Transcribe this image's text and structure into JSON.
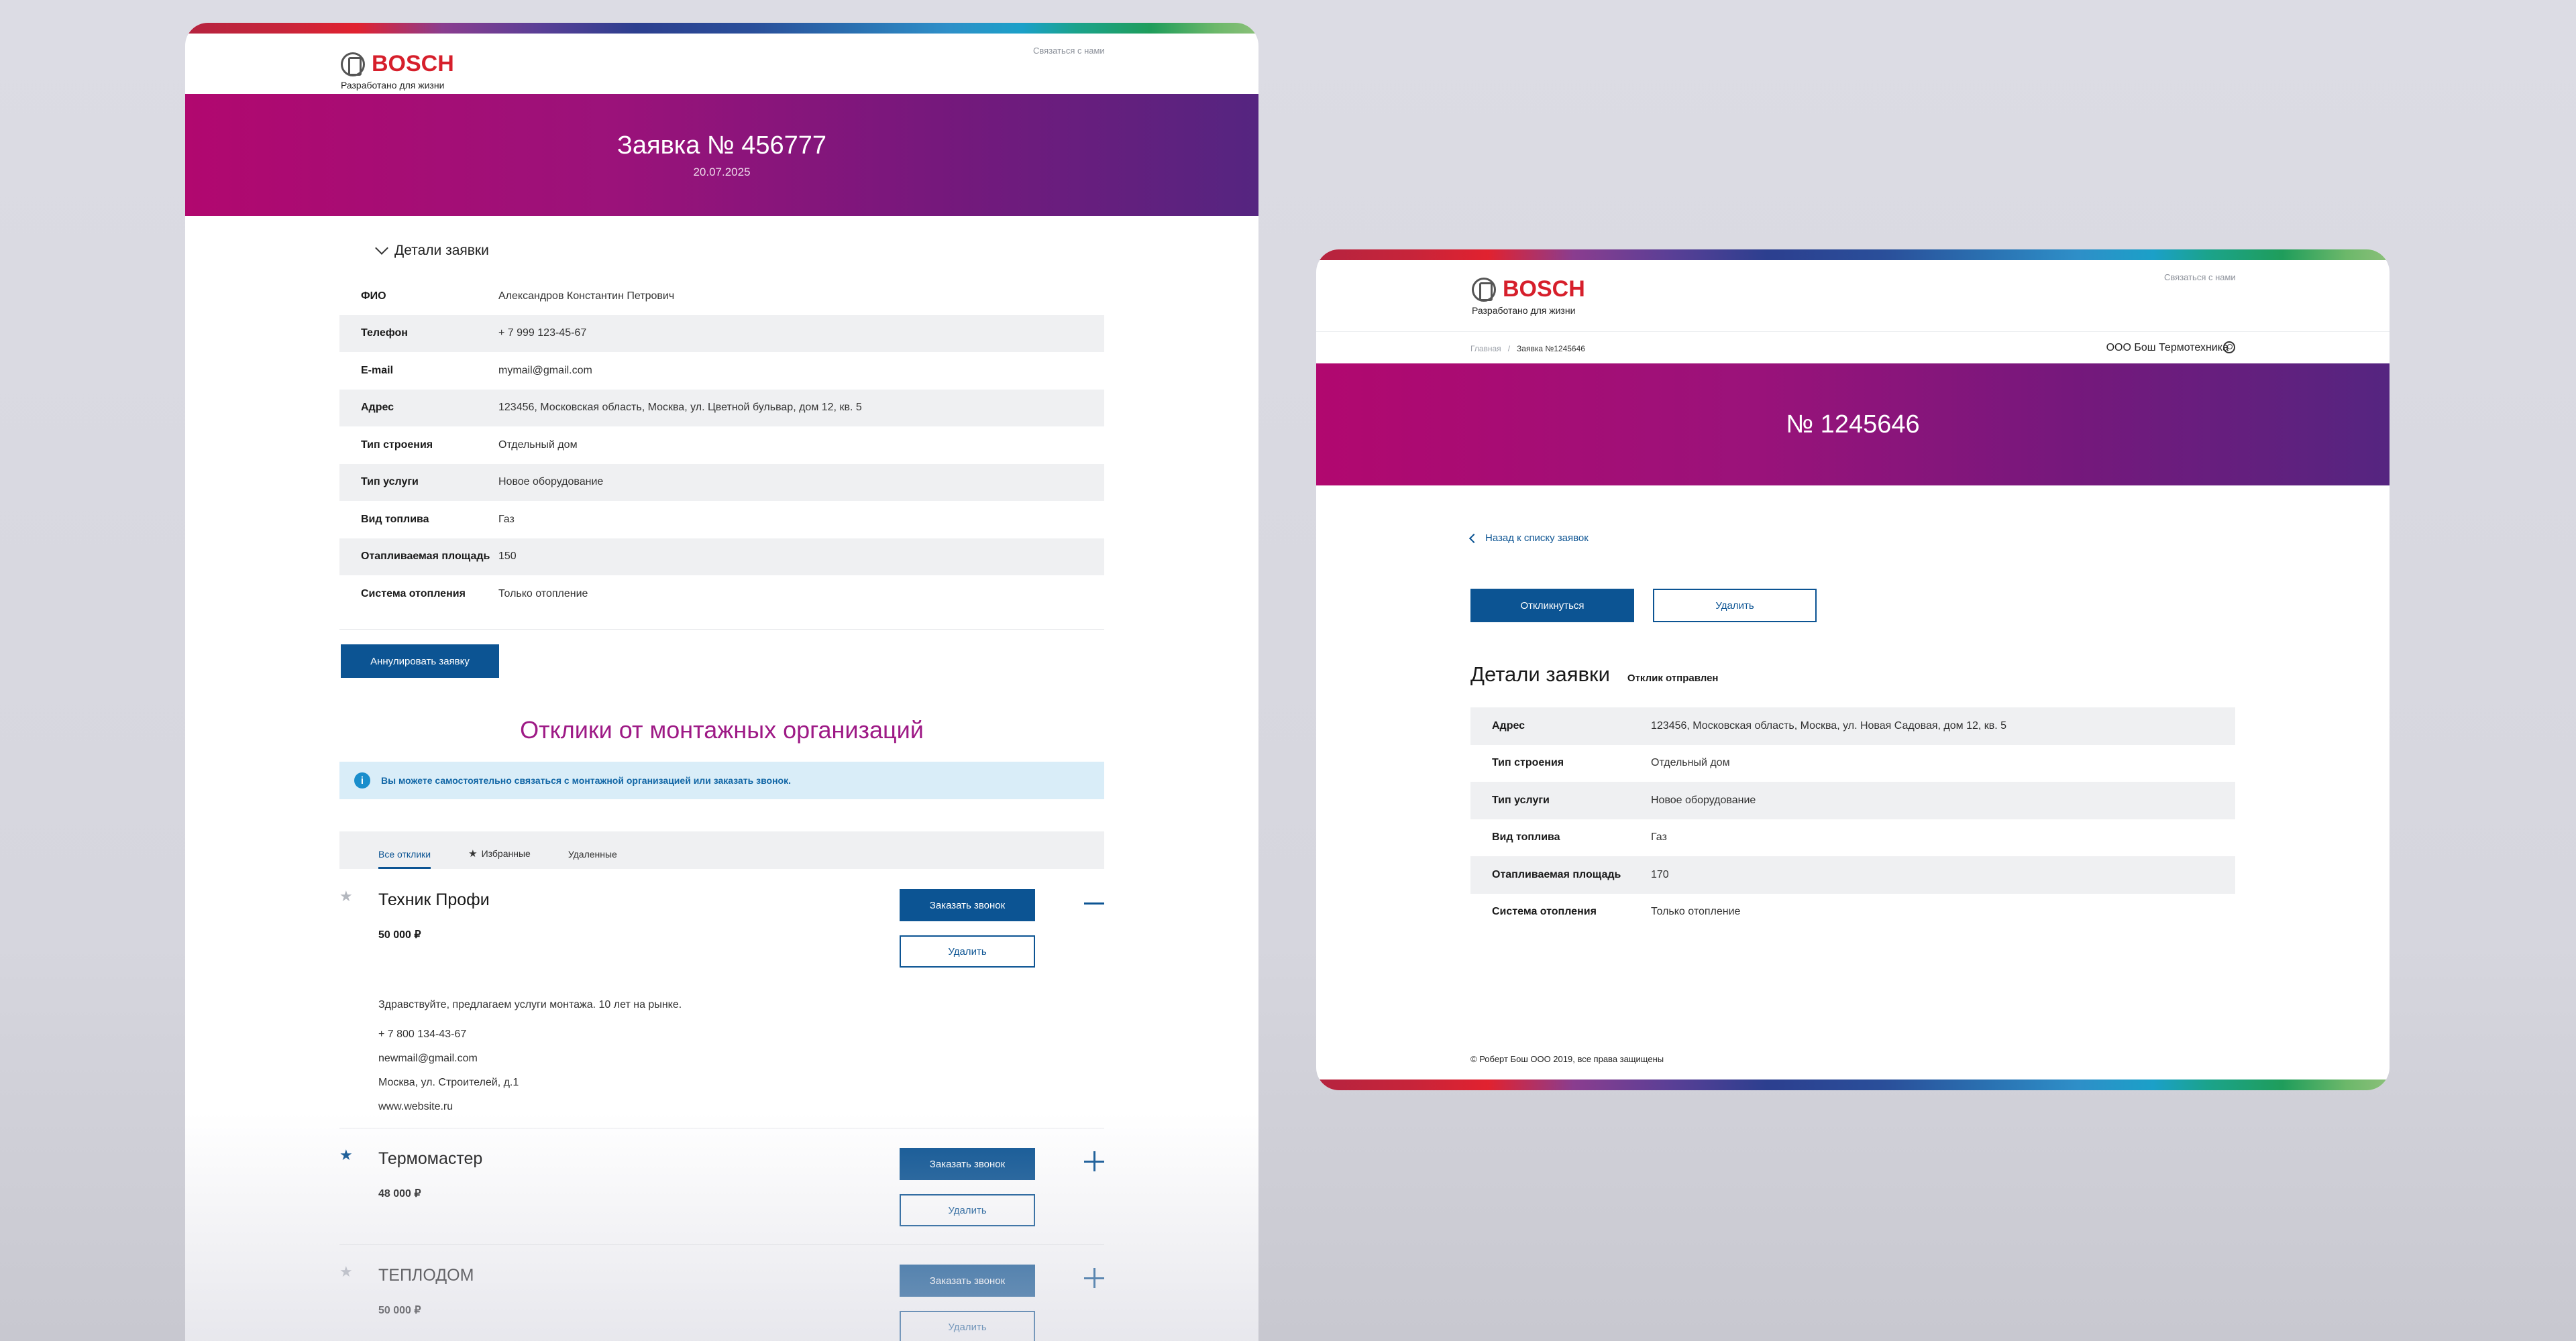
{
  "left": {
    "brand": {
      "name": "BOSCH",
      "slogan": "Разработано для жизни"
    },
    "contact": "Связаться с нами",
    "title": "Заявка № 456777",
    "date": "20.07.2025",
    "details_toggle": "Детали заявки",
    "details": [
      {
        "label": "ФИО",
        "value": "Александров Константин Петрович"
      },
      {
        "label": "Телефон",
        "value": "+ 7 999 123-45-67"
      },
      {
        "label": "E-mail",
        "value": "mymail@gmail.com"
      },
      {
        "label": "Адрес",
        "value": "123456, Московская область, Москва, ул. Цветной бульвар, дом 12, кв. 5"
      },
      {
        "label": "Тип строения",
        "value": "Отдельный дом"
      },
      {
        "label": "Тип услуги",
        "value": "Новое оборудование"
      },
      {
        "label": "Вид топлива",
        "value": "Газ"
      },
      {
        "label": "Отапливаемая площадь",
        "value": "150"
      },
      {
        "label": "Система отопления",
        "value": "Только отопление"
      }
    ],
    "cancel_button": "Аннулировать заявку",
    "responses_title": "Отклики от монтажных организаций",
    "info_text": "Вы можете самостоятельно связаться с монтажной организацией или заказать звонок.",
    "tabs": [
      {
        "label": "Все отклики",
        "active": true,
        "icon": ""
      },
      {
        "label": "Избранные",
        "active": false,
        "icon": "star-icon"
      },
      {
        "label": "Удаленные",
        "active": false,
        "icon": ""
      }
    ],
    "responses": [
      {
        "name": "Техник Профи",
        "price": "50 000 ₽",
        "favorite": false,
        "expanded": true,
        "message": "Здравствуйте, предлагаем услуги монтажа. 10 лет на рынке.",
        "phone": "+ 7 800 134-43-67",
        "email": "newmail@gmail.com",
        "address": "Москва, ул. Строителей, д.1",
        "website": "www.website.ru",
        "call_button": "Заказать звонок",
        "delete_button": "Удалить"
      },
      {
        "name": "Термомастер",
        "price": "48 000 ₽",
        "favorite": true,
        "expanded": false,
        "call_button": "Заказать звонок",
        "delete_button": "Удалить"
      },
      {
        "name": "ТЕПЛОДОМ",
        "price": "50 000 ₽",
        "favorite": false,
        "expanded": false,
        "call_button": "Заказать звонок",
        "delete_button": "Удалить"
      }
    ]
  },
  "right": {
    "brand": {
      "name": "BOSCH",
      "slogan": "Разработано для жизни"
    },
    "contact": "Связаться с нами",
    "breadcrumb": {
      "home": "Главная",
      "separator": "/",
      "current": "Заявка №1245646"
    },
    "company": "ООО Бош Термотехника",
    "title": "№ 1245646",
    "back_link": "Назад к списку заявок",
    "respond_button": "Откликнуться",
    "delete_button": "Удалить",
    "details_title": "Детали заявки",
    "status": "Отклик отправлен",
    "details": [
      {
        "label": "Адрес",
        "value": "123456, Московская область, Москва, ул. Новая Садовая, дом 12, кв. 5"
      },
      {
        "label": "Тип строения",
        "value": "Отдельный дом"
      },
      {
        "label": "Тип услуги",
        "value": "Новое оборудование"
      },
      {
        "label": "Вид топлива",
        "value": "Газ"
      },
      {
        "label": "Отапливаемая площадь",
        "value": "170"
      },
      {
        "label": "Система отопления",
        "value": "Только отопление"
      }
    ],
    "footer": "© Роберт Бош ООО 2019, все права защищены"
  },
  "colors": {
    "accent_blue": "#0c5493",
    "hero_start": "#b1086f",
    "hero_end": "#552580",
    "section_title": "#9e1a86",
    "brand_red": "#d61f2b"
  }
}
